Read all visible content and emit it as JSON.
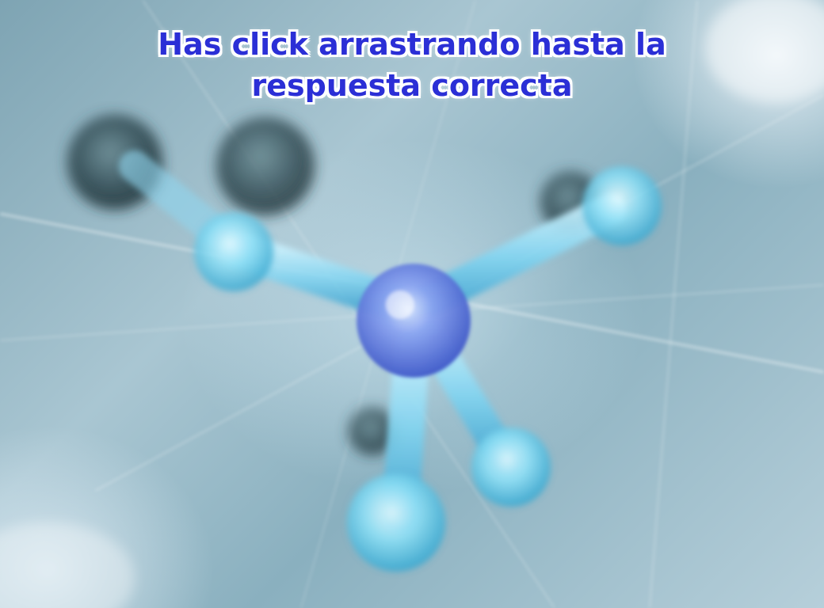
{
  "slide": {
    "instruction": "Has click arrastrando hasta la respuesta correcta"
  }
}
